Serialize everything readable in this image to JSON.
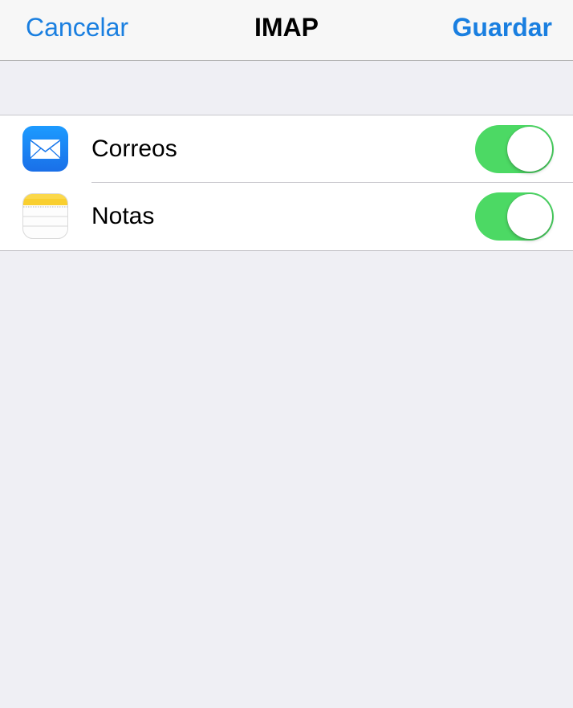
{
  "navbar": {
    "cancel_label": "Cancelar",
    "title": "IMAP",
    "save_label": "Guardar"
  },
  "accent_color": "#1a7fe0",
  "toggle_on_color": "#4cd964",
  "settings": [
    {
      "label": "Correos",
      "icon": "mail-icon",
      "enabled": true
    },
    {
      "label": "Notas",
      "icon": "notes-icon",
      "enabled": true
    }
  ]
}
